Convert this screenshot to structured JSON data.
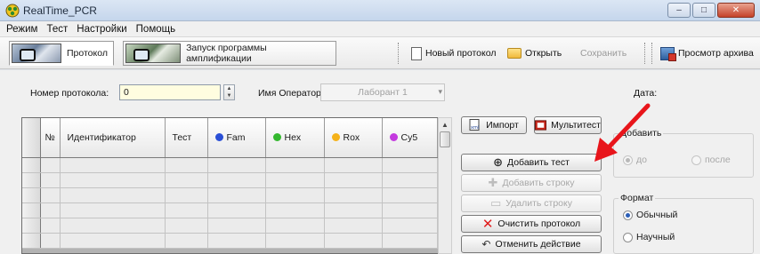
{
  "window": {
    "title": "RealTime_PCR",
    "minimize": "–",
    "maximize": "□",
    "close": "✕"
  },
  "menu": [
    "Режим",
    "Тест",
    "Настройки",
    "Помощь"
  ],
  "toolbar": {
    "tab_protocol": "Протокол",
    "tab_run": "Запуск программы амплификации",
    "new_protocol": "Новый протокол",
    "open": "Открыть",
    "save": "Сохранить",
    "archive": "Просмотр архива"
  },
  "form": {
    "protocol_number_label": "Номер протокола:",
    "protocol_number_value": "0",
    "operator_label": "Имя Оператора:",
    "operator_value": "Лаборант 1",
    "date_label": "Дата:"
  },
  "grid": {
    "columns": [
      "№",
      "Идентификатор",
      "Тест",
      "Fam",
      "Hex",
      "Rox",
      "Cy5"
    ],
    "dye_colors": {
      "Fam": "#2a4fd6",
      "Hex": "#34b82f",
      "Rox": "#f5b21a",
      "Cy5": "#c43adf"
    },
    "row_count": 6
  },
  "buttons": {
    "import": "Импорт",
    "multitest": "Мультитест",
    "add_test": "Добавить тест",
    "add_row": "Добавить строку",
    "delete_row": "Удалить строку",
    "clear_protocol": "Очистить протокол",
    "undo": "Отменить действие"
  },
  "add_group": {
    "title": "Добавить",
    "before": "до",
    "after": "после",
    "selected": "до"
  },
  "format_group": {
    "title": "Формат",
    "normal": "Обычный",
    "scientific": "Научный",
    "selected": "Обычный"
  },
  "annotation_color": "#e8151b"
}
